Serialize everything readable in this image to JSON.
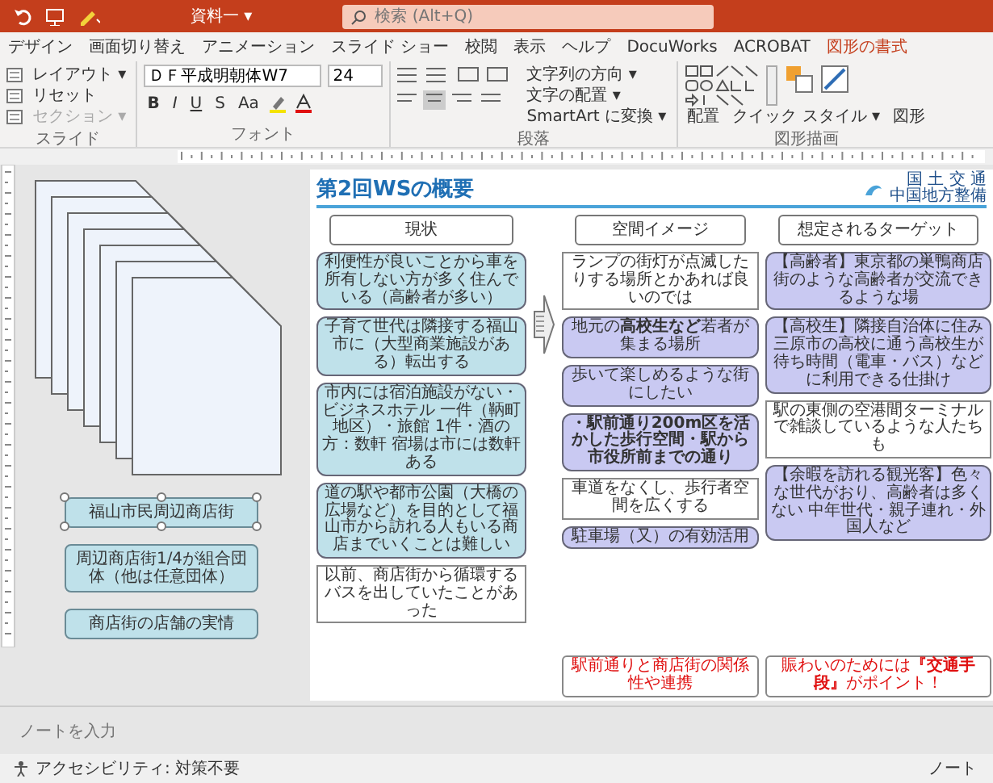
{
  "title_bar": {
    "document": "資料一 ▾",
    "search_placeholder": "検索 (Alt+Q)"
  },
  "ribbon_tabs": [
    {
      "label": "デザイン",
      "contextual": false
    },
    {
      "label": "画面切り替え",
      "contextual": false
    },
    {
      "label": "アニメーション",
      "contextual": false
    },
    {
      "label": "スライド ショー",
      "contextual": false
    },
    {
      "label": "校閲",
      "contextual": false
    },
    {
      "label": "表示",
      "contextual": false
    },
    {
      "label": "ヘルプ",
      "contextual": false
    },
    {
      "label": "DocuWorks",
      "contextual": false
    },
    {
      "label": "ACROBAT",
      "contextual": false
    },
    {
      "label": "図形の書式",
      "contextual": true
    }
  ],
  "ribbon": {
    "slide_group": {
      "label": "スライド",
      "buttons": [
        {
          "label": "レイアウト ▾",
          "disabled": false
        },
        {
          "label": "リセット",
          "disabled": false
        },
        {
          "label": "セクション ▾",
          "disabled": true
        }
      ]
    },
    "font_group": {
      "label": "フォント",
      "font_name": "ＤＦ平成明朝体W7",
      "font_size": "24",
      "format_buttons": [
        "B",
        "I",
        "U",
        "S",
        "Aa"
      ]
    },
    "paragraph_group": {
      "label": "段落",
      "buttons": [
        "文字列の方向 ▾",
        "文字の配置 ▾",
        "SmartArt に変換 ▾"
      ]
    },
    "drawing_group": {
      "label": "図形描画",
      "buttons": [
        "配置",
        "クイック スタイル ▾",
        "図形"
      ]
    }
  },
  "offslide_shapes": [
    {
      "text": "福山市民周辺商店街",
      "selected": true
    },
    {
      "text": "周辺商店街1/4が組合団体（他は任意団体）",
      "selected": false
    },
    {
      "text": "商店街の店舗の実情",
      "selected": false
    }
  ],
  "slide": {
    "title": "第2回WSの概要",
    "org": [
      "国 土 交 通",
      "中国地方整備"
    ],
    "columns": [
      {
        "header": "現状",
        "color": "#bfe1ea",
        "items": [
          {
            "kind": "box",
            "text": "利便性が良いことから車を所有しない方が多く住んでいる（高齢者が多い）"
          },
          {
            "kind": "box",
            "text": "子育て世代は隣接する福山市に（大型商業施設がある）転出する"
          },
          {
            "kind": "box",
            "text": "市内には宿泊施設がない・ビジネスホテル 一件（鞆町地区）・旅館 1件・酒の方：数軒 宿場は市には数軒ある"
          },
          {
            "kind": "box",
            "text": "道の駅や都市公園（大橋の広場など）を目的として福山市から訪れる人もいる商店までいくことは難しい"
          },
          {
            "kind": "callout",
            "text": "以前、商店街から循環するバスを出していたことがあった"
          }
        ]
      },
      {
        "header": "空間イメージ",
        "color": "#c9c9f2",
        "items": [
          {
            "kind": "callout",
            "text": "ランプの街灯が点滅したりする場所とかあれば良いのでは"
          },
          {
            "kind": "box",
            "text": "地元の**高校生など**若者が集まる場所"
          },
          {
            "kind": "box",
            "text": "歩いて楽しめるような街にしたい"
          },
          {
            "kind": "box",
            "text": "**・駅前通り200m区を活かした歩行空間・駅から市役所前までの通り**"
          },
          {
            "kind": "callout",
            "text": "車道をなくし、歩行者空間を広くする"
          },
          {
            "kind": "box",
            "text": "駐車場（又）の有効活用"
          },
          {
            "kind": "conclusion",
            "text": "駅前通りと商店街の関係性や連携"
          }
        ]
      },
      {
        "header": "想定されるターゲット",
        "color": "#c9c9f2",
        "items": [
          {
            "kind": "box",
            "text": "【高齢者】東京都の巣鴨商店街のような高齢者が交流できるような場"
          },
          {
            "kind": "box",
            "text": "【高校生】隣接自治体に住み三原市の高校に通う高校生が待ち時間（電車・バス）などに利用できる仕掛け"
          },
          {
            "kind": "callout",
            "text": "駅の東側の空港間ターミナルで雑談しているような人たちも"
          },
          {
            "kind": "box",
            "text": "【余暇を訪れる観光客】色々な世代がおり、高齢者は多くない 中年世代・親子連れ・外国人など"
          },
          {
            "kind": "conclusion",
            "text": "賑わいのためには**『交通手段』**がポイント！"
          }
        ]
      }
    ]
  },
  "notes": {
    "placeholder": "ノートを入力"
  },
  "status_bar": {
    "accessibility": "アクセシビリティ: 対策不要",
    "notes_button": "ノート"
  }
}
